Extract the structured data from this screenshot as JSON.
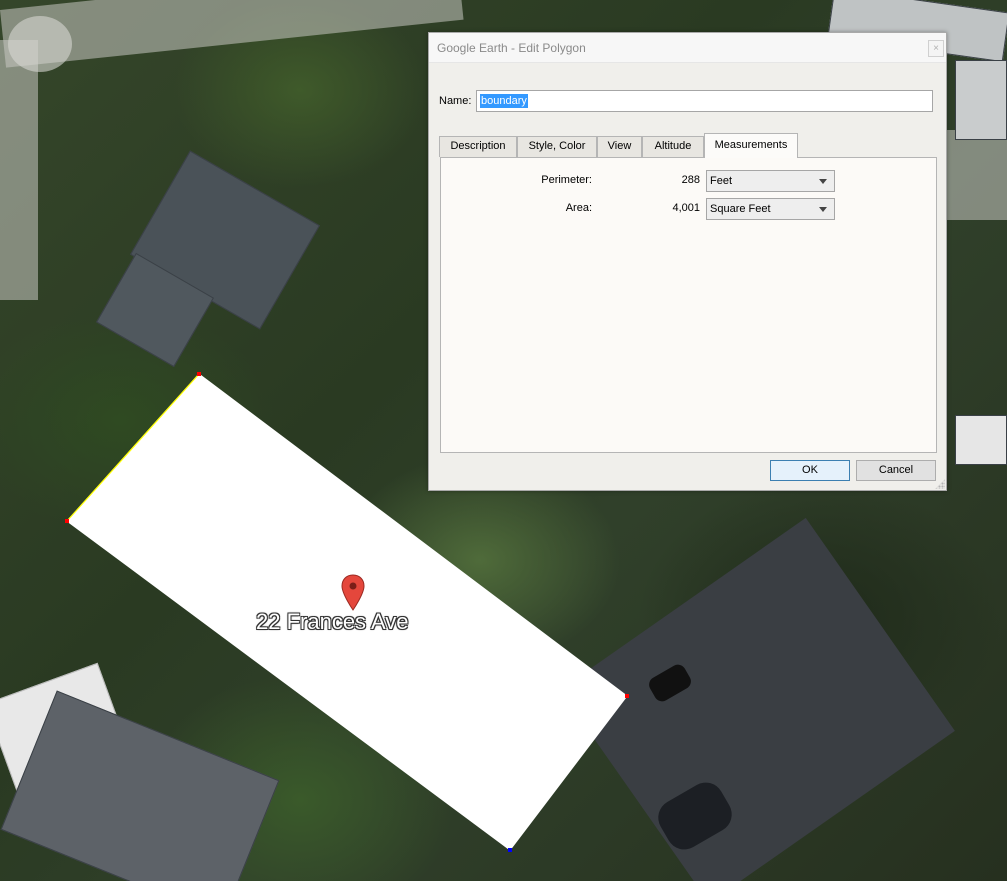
{
  "dialog": {
    "title": "Google Earth - Edit Polygon",
    "close_label": "×",
    "name_label": "Name:",
    "name_value": "boundary",
    "tabs": [
      {
        "label": "Description"
      },
      {
        "label": "Style, Color"
      },
      {
        "label": "View"
      },
      {
        "label": "Altitude"
      },
      {
        "label": "Measurements",
        "active": true
      }
    ],
    "measurements": {
      "perimeter": {
        "label": "Perimeter:",
        "value": "288",
        "unit": "Feet"
      },
      "area": {
        "label": "Area:",
        "value": "4,001",
        "unit": "Square Feet"
      }
    },
    "ok_label": "OK",
    "cancel_label": "Cancel"
  },
  "map": {
    "placemark_label": "22 Frances Ave",
    "placemark_icon": "map-pin-icon",
    "polygon_fill": "#ffffff",
    "edge_highlight_color": "#ffff00",
    "vertex_color": "#ff0000",
    "active_vertex_color": "#0000ff",
    "pin_color": "#e4473c"
  }
}
